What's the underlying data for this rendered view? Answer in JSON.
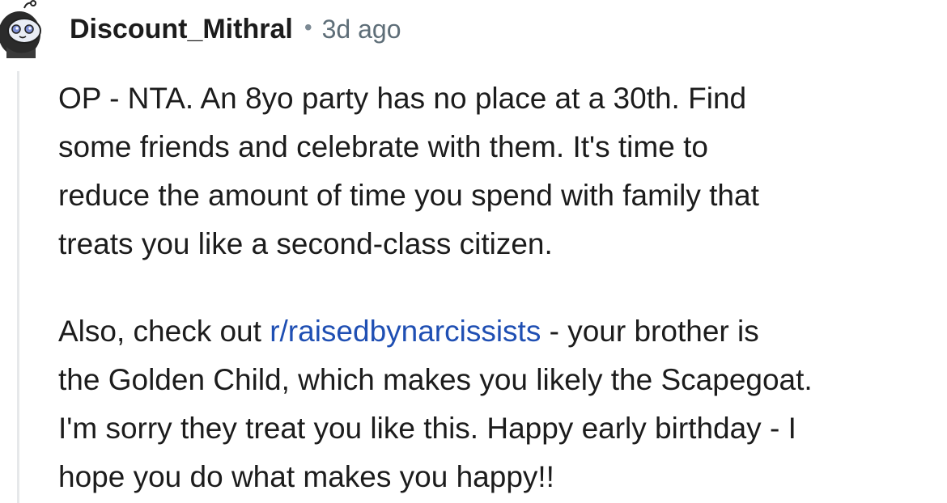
{
  "comment": {
    "author": "Discount_Mithral",
    "separator": "•",
    "timestamp": "3d ago",
    "avatar_icon": "snoo-avatar-icon",
    "paragraph1": {
      "lines": [
        "OP - NTA. An 8yo party has no place at a 30th. Find",
        "some friends and celebrate with them. It's time to",
        "reduce the amount of time you spend with family that",
        "treats you like a second-class citizen."
      ]
    },
    "paragraph2": {
      "line1_prefix": "Also, check out ",
      "link": "r/raisedbynarcissists",
      "line1_suffix": " - your brother is",
      "lines": [
        "the Golden Child, which makes you likely the Scapegoat.",
        "I'm sorry they treat you like this. Happy early birthday - I",
        "hope you do what makes you happy!!"
      ]
    }
  },
  "colors": {
    "text": "#1c1c1c",
    "meta": "#5e6e78",
    "link": "#1f4fb3",
    "thread_line": "#e6e8ea"
  }
}
